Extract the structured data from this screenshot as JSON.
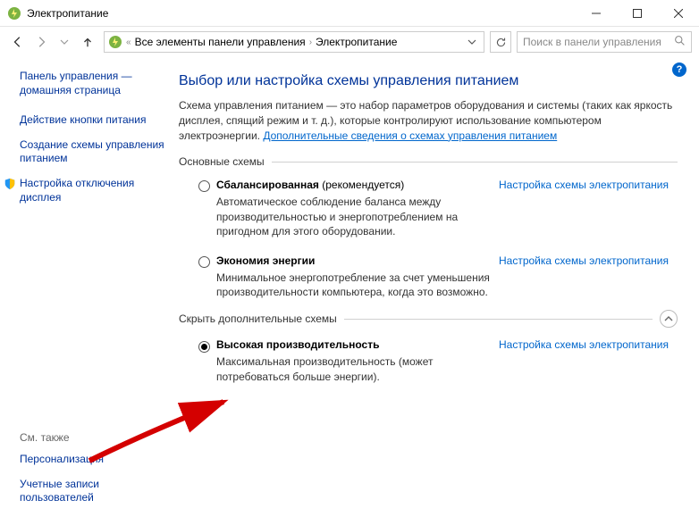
{
  "window": {
    "title": "Электропитание"
  },
  "breadcrumb": {
    "root": "Все элементы панели управления",
    "current": "Электропитание"
  },
  "search": {
    "placeholder": "Поиск в панели управления"
  },
  "sidebar": {
    "home": "Панель управления — домашняя страница",
    "items": [
      "Действие кнопки питания",
      "Создание схемы управления питанием",
      "Настройка отключения дисплея"
    ],
    "see_also_heading": "См. также",
    "see_also": [
      "Персонализация",
      "Учетные записи пользователей"
    ]
  },
  "main": {
    "title": "Выбор или настройка схемы управления питанием",
    "desc_pre": "Схема управления питанием — это набор параметров оборудования и системы (таких как яркость дисплея, спящий режим и т. д.), которые контролируют использование компьютером электроэнергии. ",
    "desc_link": "Дополнительные сведения о схемах управления питанием",
    "section_basic": "Основные схемы",
    "section_extra": "Скрыть дополнительные схемы",
    "config_link": "Настройка схемы электропитания",
    "plans": {
      "balanced": {
        "name_bold": "Сбалансированная",
        "name_rest": " (рекомендуется)",
        "desc": "Автоматическое соблюдение баланса между производительностью и энергопотреблением на пригодном для этого оборудовании."
      },
      "saver": {
        "name_bold": "Экономия энергии",
        "name_rest": "",
        "desc": "Минимальное энергопотребление за счет уменьшения производительности компьютера, когда это возможно."
      },
      "high": {
        "name_bold": "Высокая производительность",
        "name_rest": "",
        "desc": "Максимальная производительность (может потребоваться больше энергии)."
      }
    }
  }
}
